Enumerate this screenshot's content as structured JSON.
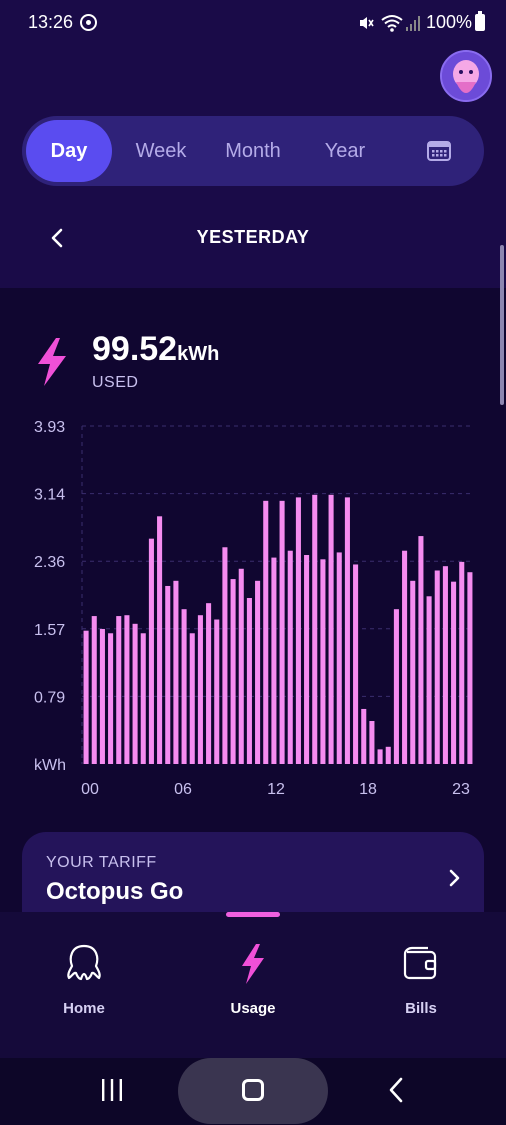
{
  "status_bar": {
    "time": "13:26",
    "battery": "100%"
  },
  "tabs": [
    {
      "label": "Day",
      "active": true
    },
    {
      "label": "Week",
      "active": false
    },
    {
      "label": "Month",
      "active": false
    },
    {
      "label": "Year",
      "active": false
    }
  ],
  "period": {
    "title": "YESTERDAY"
  },
  "usage": {
    "value": "99.52",
    "unit": "kWh",
    "label": "USED"
  },
  "chart_data": {
    "type": "bar",
    "ylabel": "kWh",
    "ylim": [
      0,
      3.93
    ],
    "yticks": [
      "3.93",
      "3.14",
      "2.36",
      "1.57",
      "0.79",
      "kWh"
    ],
    "xticks": [
      "00",
      "06",
      "12",
      "18",
      "23"
    ],
    "grid": true,
    "color": "#f58cf0",
    "values": [
      1.55,
      1.72,
      1.57,
      1.52,
      1.72,
      1.73,
      1.63,
      1.52,
      2.62,
      2.88,
      2.07,
      2.13,
      1.8,
      1.52,
      1.73,
      1.87,
      1.68,
      2.52,
      2.15,
      2.27,
      1.93,
      2.13,
      3.06,
      2.4,
      3.06,
      2.48,
      3.1,
      2.43,
      3.13,
      2.38,
      3.13,
      2.46,
      3.1,
      2.32,
      0.64,
      0.5,
      0.17,
      0.2,
      1.8,
      2.48,
      2.13,
      2.65,
      1.95,
      2.25,
      2.3,
      2.12,
      2.35,
      2.23
    ]
  },
  "tariff": {
    "label": "YOUR TARIFF",
    "name": "Octopus Go"
  },
  "bottom_nav": [
    {
      "label": "Home",
      "icon": "octopus-icon",
      "active": false
    },
    {
      "label": "Usage",
      "icon": "lightning-icon",
      "active": true
    },
    {
      "label": "Bills",
      "icon": "wallet-icon",
      "active": false
    }
  ],
  "colors": {
    "background": "#100630",
    "header": "#1a0b48",
    "accent": "#5a4cf0",
    "pink": "#f58cf0"
  }
}
